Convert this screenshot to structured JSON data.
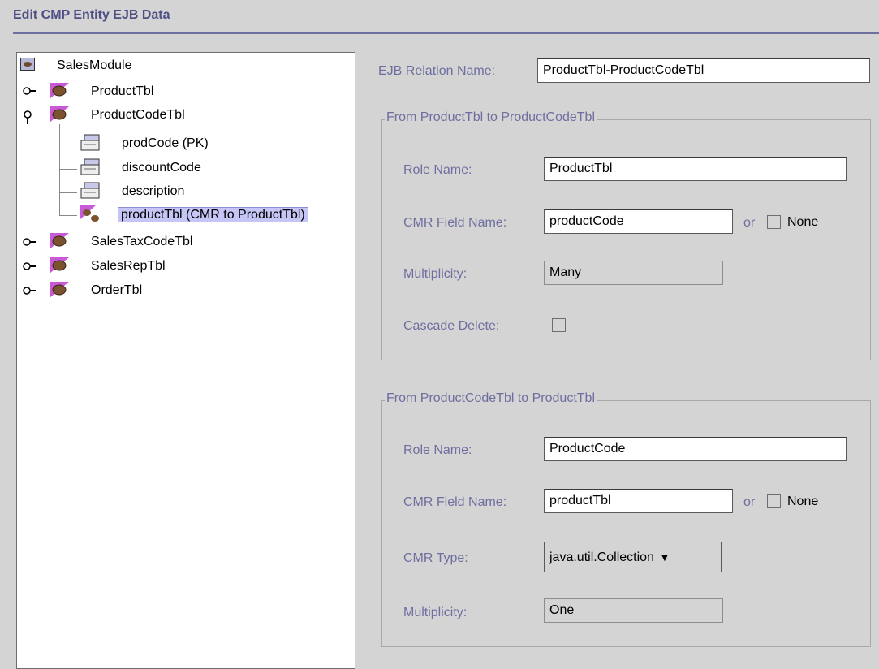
{
  "header": {
    "title": "Edit CMP Entity EJB Data"
  },
  "tree": {
    "root": "SalesModule",
    "nodes": [
      {
        "label": "ProductTbl"
      },
      {
        "label": "ProductCodeTbl"
      },
      {
        "label": "prodCode (PK)"
      },
      {
        "label": "discountCode"
      },
      {
        "label": "description"
      },
      {
        "label": "productTbl (CMR to ProductTbl)"
      },
      {
        "label": "SalesTaxCodeTbl"
      },
      {
        "label": "SalesRepTbl"
      },
      {
        "label": "OrderTbl"
      }
    ]
  },
  "relation": {
    "label": "EJB Relation Name:",
    "value": "ProductTbl-ProductCodeTbl"
  },
  "from1": {
    "title": "From ProductTbl to ProductCodeTbl",
    "role_label": "Role Name:",
    "role_value": "ProductTbl",
    "cmr_label": "CMR Field Name:",
    "cmr_value": "productCode",
    "or": "or",
    "none": "None",
    "mult_label": "Multiplicity:",
    "mult_value": "Many",
    "cascade_label": "Cascade Delete:"
  },
  "from2": {
    "title": "From ProductCodeTbl  to ProductTbl",
    "role_label": "Role Name:",
    "role_value": "ProductCode",
    "cmr_label": "CMR Field Name:",
    "cmr_value": "productTbl",
    "or": "or",
    "none": "None",
    "type_label": "CMR Type:",
    "type_value": "java.util.Collection",
    "mult_label": "Multiplicity:",
    "mult_value": "One"
  },
  "colors": {
    "label": "#6e6ea0",
    "selection": "#c6c6f6",
    "background": "#d4d4d4"
  }
}
